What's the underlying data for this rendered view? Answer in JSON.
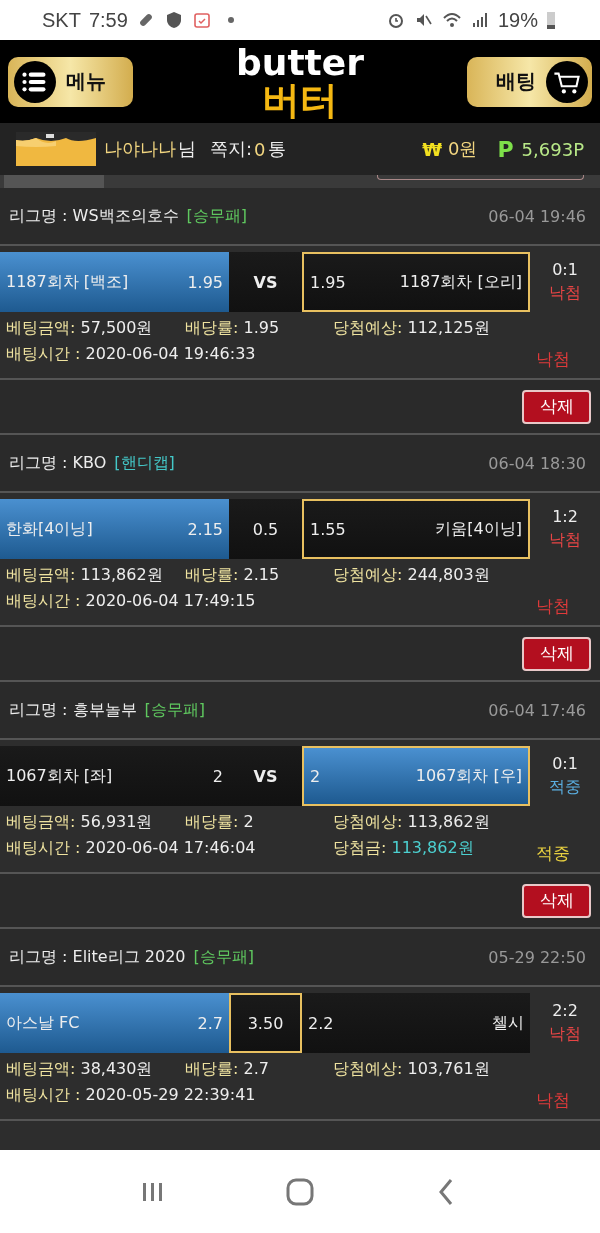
{
  "status_bar": {
    "carrier": "SKT",
    "time": "7:59",
    "battery": "19%"
  },
  "header": {
    "menu_button": "메뉴",
    "logo_en": "butter",
    "logo_ko": "버터",
    "bet_button": "배팅"
  },
  "user_bar": {
    "name": "나야나나",
    "suffix": "님",
    "message_label": "쪽지:",
    "message_count": "0",
    "message_unit": "통",
    "won_symbol": "₩",
    "money": "0원",
    "points_symbol": "P",
    "points": "5,693P"
  },
  "bets": [
    {
      "league_label": "리그명 : WS백조의호수",
      "type": {
        "text": "[승무패]",
        "color": "#5fc85f"
      },
      "date": "06-04 19:46",
      "home": {
        "name": "1187회차 [백조]",
        "odds": "1.95",
        "selected": true,
        "outlined": false
      },
      "middle": {
        "text": "VS",
        "bold": true,
        "selected": false,
        "outlined": false
      },
      "away": {
        "odds": "1.95",
        "name": "1187회차 [오리]",
        "selected": false,
        "outlined": true
      },
      "score": "0:1",
      "result": {
        "kind": "lose",
        "text": "낙첨"
      },
      "amount_label": "베팅금액:",
      "amount": "57,500원",
      "rate_label": "배당률:",
      "rate": "1.95",
      "expected_label": "당첨예상:",
      "expected": "112,125원",
      "time_label": "배팅시간 :",
      "time": "2020-06-04 19:46:33",
      "final": {
        "kind": "lose",
        "text": "낙첨"
      },
      "delete": "삭제"
    },
    {
      "league_label": "리그명 : KBO",
      "type": {
        "text": "[핸디캡]",
        "color": "#44c8c8"
      },
      "date": "06-04 18:30",
      "home": {
        "name": "한화[4이닝]",
        "odds": "2.15",
        "selected": true,
        "outlined": false
      },
      "middle": {
        "text": "0.5",
        "bold": false,
        "selected": false,
        "outlined": false
      },
      "away": {
        "odds": "1.55",
        "name": "키움[4이닝]",
        "selected": false,
        "outlined": true
      },
      "score": "1:2",
      "result": {
        "kind": "lose",
        "text": "낙첨"
      },
      "amount_label": "베팅금액:",
      "amount": "113,862원",
      "rate_label": "배당률:",
      "rate": "2.15",
      "expected_label": "당첨예상:",
      "expected": "244,803원",
      "time_label": "배팅시간 :",
      "time": "2020-06-04 17:49:15",
      "final": {
        "kind": "lose",
        "text": "낙첨"
      },
      "delete": "삭제"
    },
    {
      "league_label": "리그명 : 흥부놀부",
      "type": {
        "text": "[승무패]",
        "color": "#5fc85f"
      },
      "date": "06-04 17:46",
      "home": {
        "name": "1067회차 [좌]",
        "odds": "2",
        "selected": false,
        "outlined": false
      },
      "middle": {
        "text": "VS",
        "bold": true,
        "selected": false,
        "outlined": false
      },
      "away": {
        "odds": "2",
        "name": "1067회차 [우]",
        "selected": true,
        "outlined": true
      },
      "score": "0:1",
      "result": {
        "kind": "win",
        "text": "적중"
      },
      "amount_label": "베팅금액:",
      "amount": "56,931원",
      "rate_label": "배당률:",
      "rate": "2",
      "expected_label": "당첨예상:",
      "expected": "113,862원",
      "time_label": "배팅시간 :",
      "time": "2020-06-04 17:46:04",
      "winnings_label": "당첨금:",
      "winnings": "113,862원",
      "final": {
        "kind": "win",
        "text": "적중"
      },
      "delete": "삭제"
    },
    {
      "league_label": "리그명 : Elite리그 2020",
      "type": {
        "text": "[승무패]",
        "color": "#5fc85f"
      },
      "date": "05-29 22:50",
      "home": {
        "name": "아스날 FC",
        "odds": "2.7",
        "selected": true,
        "outlined": false
      },
      "middle": {
        "text": "3.50",
        "bold": false,
        "selected": false,
        "outlined": true
      },
      "away": {
        "odds": "2.2",
        "name": "첼시",
        "selected": false,
        "outlined": false
      },
      "score": "2:2",
      "result": {
        "kind": "lose",
        "text": "낙첨"
      },
      "amount_label": "베팅금액:",
      "amount": "38,430원",
      "rate_label": "배당률:",
      "rate": "2.7",
      "expected_label": "당첨예상:",
      "expected": "103,761원",
      "time_label": "배팅시간 :",
      "time": "2020-05-29 22:39:41",
      "final": {
        "kind": "lose",
        "text": "낙첨"
      }
    }
  ]
}
